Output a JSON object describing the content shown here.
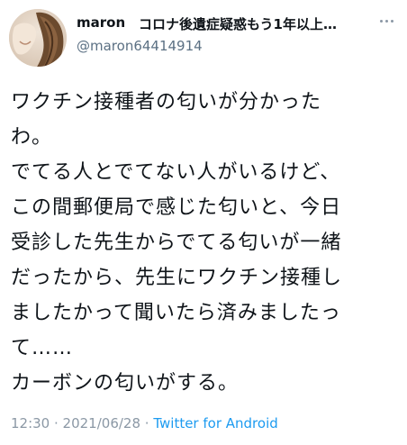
{
  "user": {
    "display_name": "maron",
    "profile_title": "コロナ後遺症疑惑もう1年以上…",
    "handle": "@maron64414914"
  },
  "tweet": {
    "text": "ワクチン接種者の匂いが分かった\nわ。\nでてる人とでてない人がいるけど、\nこの間郵便局で感じた匂いと、今日\n受診した先生からでてる匂いが一緒\nだったから、先生にワクチン接種し\nましたかって聞いたら済みましたっ\nて……\nカーボンの匂いがする。"
  },
  "meta": {
    "time": "12:30",
    "separator": " · ",
    "date": "2021/06/28",
    "source": "Twitter for Android"
  },
  "colors": {
    "text": "#0f1419",
    "secondary": "#5b7083",
    "link": "#1d9bf0"
  },
  "icons": {
    "more": "more-horizontal-icon"
  }
}
